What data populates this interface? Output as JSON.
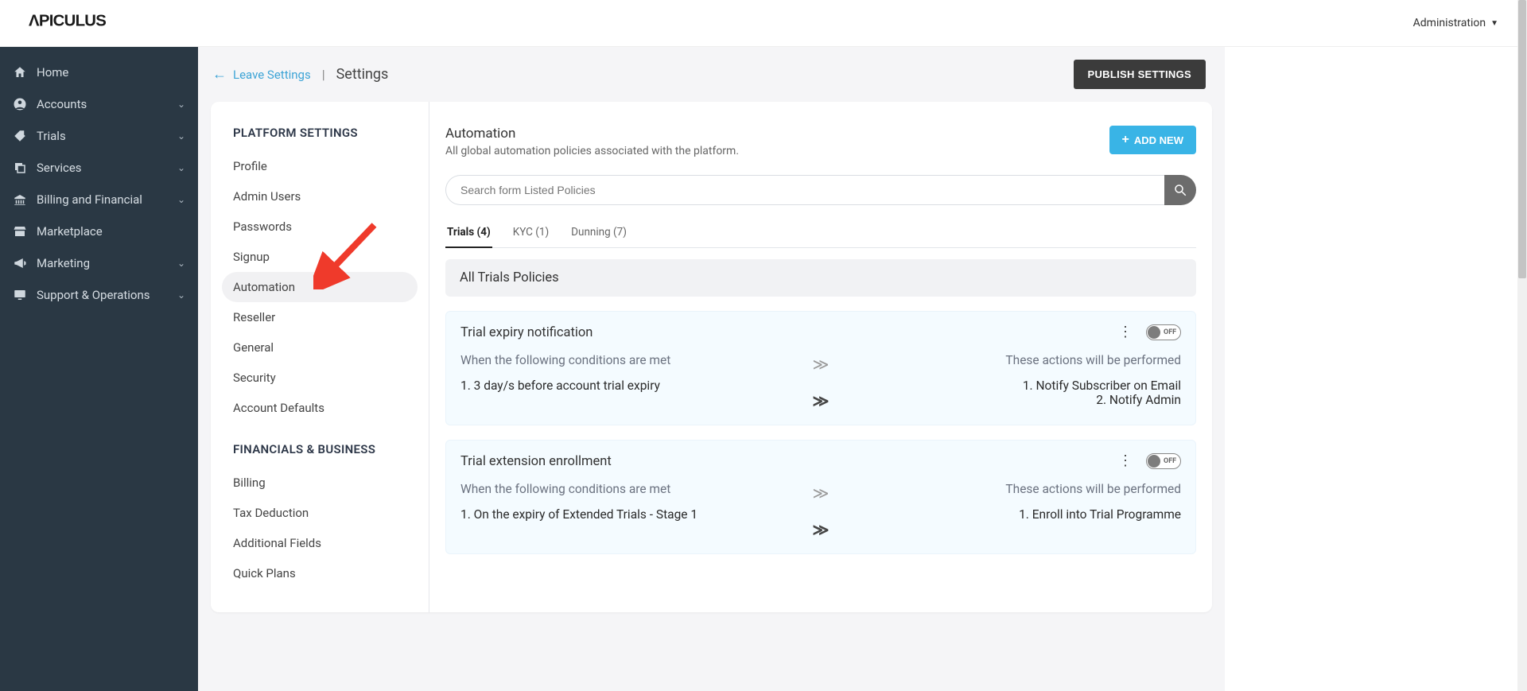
{
  "topbar": {
    "brand": "APICULUS",
    "admin_label": "Administration"
  },
  "sidebar": {
    "items": [
      {
        "icon": "home-icon",
        "label": "Home",
        "expandable": false
      },
      {
        "icon": "user-circle-icon",
        "label": "Accounts",
        "expandable": true
      },
      {
        "icon": "tag-icon",
        "label": "Trials",
        "expandable": true
      },
      {
        "icon": "layers-icon",
        "label": "Services",
        "expandable": true
      },
      {
        "icon": "bank-icon",
        "label": "Billing and Financial",
        "expandable": true
      },
      {
        "icon": "store-icon",
        "label": "Marketplace",
        "expandable": false
      },
      {
        "icon": "megaphone-icon",
        "label": "Marketing",
        "expandable": true
      },
      {
        "icon": "monitor-icon",
        "label": "Support & Operations",
        "expandable": true
      }
    ]
  },
  "crumb": {
    "back_label": "Leave Settings",
    "title": "Settings",
    "publish_label": "PUBLISH SETTINGS"
  },
  "settings_nav": {
    "section1_title": "PLATFORM SETTINGS",
    "section1_items": [
      "Profile",
      "Admin Users",
      "Passwords",
      "Signup",
      "Automation",
      "Reseller",
      "General",
      "Security",
      "Account Defaults"
    ],
    "section1_active_index": 4,
    "section2_title": "FINANCIALS & BUSINESS",
    "section2_items": [
      "Billing",
      "Tax Deduction",
      "Additional Fields",
      "Quick Plans"
    ]
  },
  "panel": {
    "title": "Automation",
    "subtitle": "All global automation policies associated with the platform.",
    "add_new_label": "ADD NEW",
    "search_placeholder": "Search form Listed Policies"
  },
  "tabs": [
    {
      "label": "Trials (4)",
      "active": true
    },
    {
      "label": "KYC (1)",
      "active": false
    },
    {
      "label": "Dunning (7)",
      "active": false
    }
  ],
  "section_banner": "All Trials Policies",
  "cond_header": "When the following conditions are met",
  "act_header": "These actions will be performed",
  "toggle_off_label": "OFF",
  "policies": [
    {
      "title": "Trial expiry notification",
      "conditions": [
        "1. 3 day/s before account trial expiry"
      ],
      "actions": [
        "1. Notify Subscriber on Email",
        "2. Notify Admin"
      ]
    },
    {
      "title": "Trial extension enrollment",
      "conditions": [
        "1. On the expiry of Extended Trials - Stage 1"
      ],
      "actions": [
        "1. Enroll into Trial Programme"
      ]
    }
  ]
}
